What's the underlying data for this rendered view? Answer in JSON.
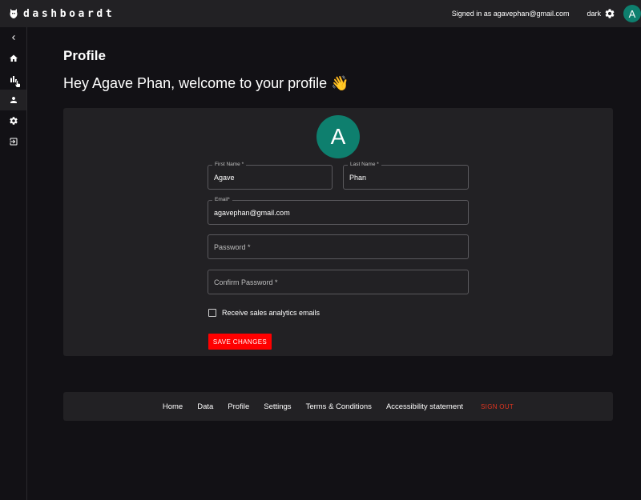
{
  "app": {
    "name": "dashboardt"
  },
  "header": {
    "signed_in": "Signed in as agavephan@gmail.com",
    "theme_label": "dark",
    "avatar_initial": "A"
  },
  "page": {
    "title": "Profile",
    "welcome": "Hey Agave Phan, welcome to your profile 👋"
  },
  "form": {
    "avatar_initial": "A",
    "first_name": {
      "label": "First Name",
      "required": "*",
      "value": "Agave"
    },
    "last_name": {
      "label": "Last Name",
      "required": "*",
      "value": "Phan"
    },
    "email": {
      "label": "Email",
      "required": "*",
      "value": "agavephan@gmail.com"
    },
    "password": {
      "placeholder": "Password",
      "required": "*"
    },
    "confirm_password": {
      "placeholder": "Confirm Password",
      "required": "*"
    },
    "checkbox_label": "Receive sales analytics emails",
    "checkbox_checked": false,
    "save_label": "SAVE CHANGES"
  },
  "footer": {
    "links": [
      "Home",
      "Data",
      "Profile",
      "Settings",
      "Terms & Conditions",
      "Accessibility statement"
    ],
    "signout": "SIGN OUT"
  },
  "colors": {
    "accent": "#ff0000",
    "avatar": "#0e7f6e",
    "signout": "#e1351f",
    "surface": "#222124",
    "background": "#121115"
  },
  "icons": [
    "chevron-left-icon",
    "home-icon",
    "bar-chart-icon",
    "person-icon",
    "gear-icon",
    "logout-icon",
    "hand-cursor-icon"
  ]
}
